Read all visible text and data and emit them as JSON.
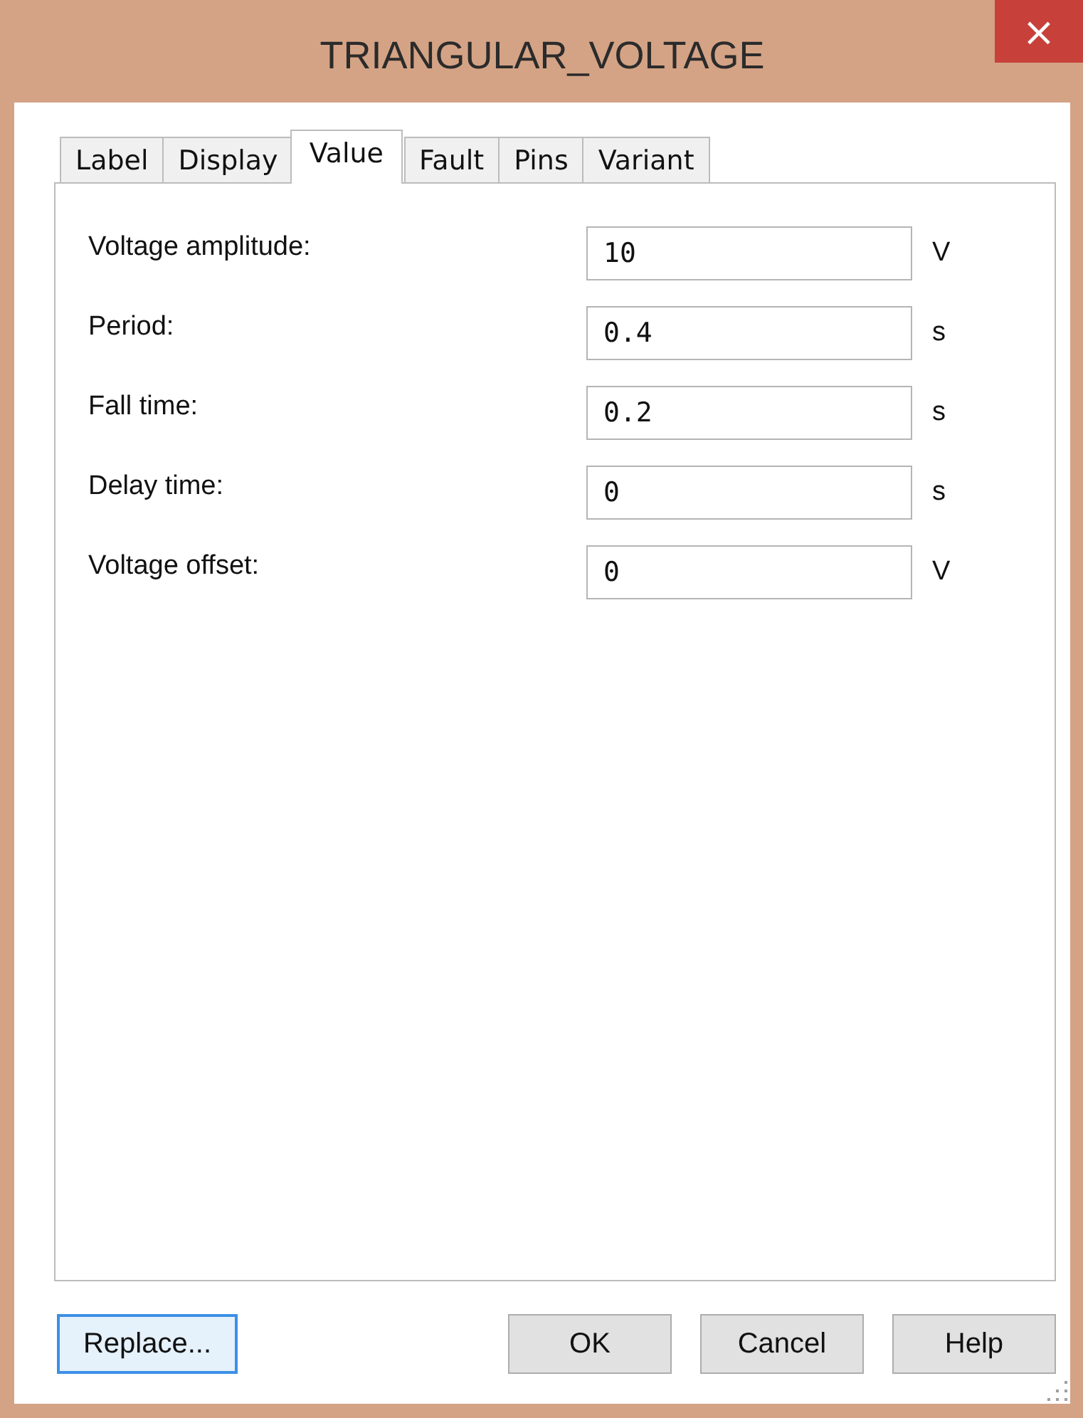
{
  "window": {
    "title": "TRIANGULAR_VOLTAGE",
    "close": "×"
  },
  "tabs": [
    {
      "label": "Label",
      "selected": false
    },
    {
      "label": "Display",
      "selected": false
    },
    {
      "label": "Value",
      "selected": true
    },
    {
      "label": "Fault",
      "selected": false
    },
    {
      "label": "Pins",
      "selected": false
    },
    {
      "label": "Variant",
      "selected": false
    }
  ],
  "fields": [
    {
      "label": "Voltage amplitude:",
      "value": "10",
      "unit": "V"
    },
    {
      "label": "Period:",
      "value": "0.4",
      "unit": "s"
    },
    {
      "label": "Fall time:",
      "value": "0.2",
      "unit": "s"
    },
    {
      "label": "Delay time:",
      "value": "0",
      "unit": "s"
    },
    {
      "label": "Voltage offset:",
      "value": "0",
      "unit": "V"
    }
  ],
  "buttons": [
    {
      "label": "Replace...",
      "focused": true
    },
    {
      "label": "OK",
      "focused": false
    },
    {
      "label": "Cancel",
      "focused": false
    },
    {
      "label": "Help",
      "focused": false
    }
  ]
}
